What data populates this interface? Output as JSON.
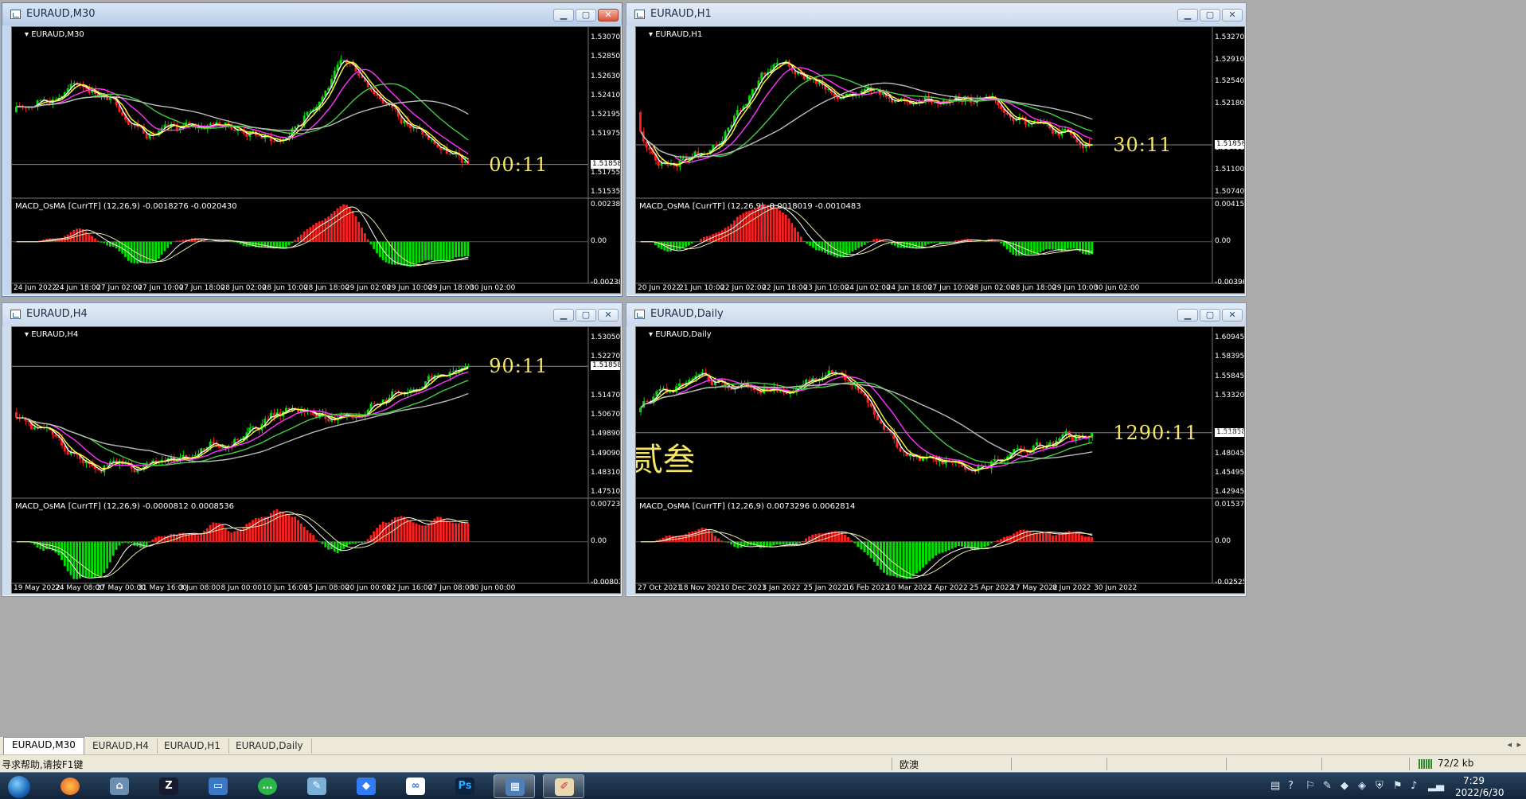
{
  "windows": [
    {
      "id": "m30",
      "title": "EURAUD,M30",
      "label": "EURAUD,M30",
      "active": true,
      "countdown": "00:11",
      "price_axis": [
        "1.53070",
        "1.52850",
        "1.52630",
        "1.52410",
        "1.52195",
        "1.51975",
        "1.51858",
        "1.51755",
        "1.51535"
      ],
      "current_price": "1.51858",
      "indicator_label": "MACD_OsMA [CurrTF] (12,26,9) -0.0018276 -0.0020430",
      "indicator_axis": [
        "0.0023855",
        "0.00",
        "-0.002383"
      ],
      "x_labels": [
        "24 Jun 2022",
        "24 Jun 18:00",
        "27 Jun 02:00",
        "27 Jun 10:00",
        "27 Jun 18:00",
        "28 Jun 02:00",
        "28 Jun 10:00",
        "28 Jun 18:00",
        "29 Jun 02:00",
        "29 Jun 10:00",
        "29 Jun 18:00",
        "30 Jun 02:00"
      ]
    },
    {
      "id": "h1",
      "title": "EURAUD,H1",
      "label": "EURAUD,H1",
      "active": false,
      "countdown": "30:11",
      "price_axis": [
        "1.53270",
        "1.52910",
        "1.52540",
        "1.52180",
        "1.51858",
        "1.51460",
        "1.51100",
        "1.50740"
      ],
      "current_price": "1.51858",
      "indicator_label": "MACD_OsMA [CurrTF] (12,26,9) -0.0018019 -0.0010483",
      "indicator_axis": [
        "0.0041574",
        "0.00",
        "-0.003964"
      ],
      "x_labels": [
        "20 Jun 2022",
        "21 Jun 10:00",
        "22 Jun 02:00",
        "22 Jun 18:00",
        "23 Jun 10:00",
        "24 Jun 02:00",
        "24 Jun 18:00",
        "27 Jun 10:00",
        "28 Jun 02:00",
        "28 Jun 18:00",
        "29 Jun 10:00",
        "30 Jun 02:00"
      ]
    },
    {
      "id": "h4",
      "title": "EURAUD,H4",
      "label": "EURAUD,H4",
      "active": false,
      "countdown": "90:11",
      "price_axis": [
        "1.53050",
        "1.52270",
        "1.51858",
        "1.51470",
        "1.50670",
        "1.49890",
        "1.49090",
        "1.48310",
        "1.47510"
      ],
      "current_price": "1.51858",
      "indicator_label": "MACD_OsMA [CurrTF] (12,26,9) -0.0000812 0.0008536",
      "indicator_axis": [
        "0.0072394",
        "0.00",
        "-0.008013"
      ],
      "x_labels": [
        "19 May 2022",
        "24 May 08:00",
        "27 May 00:00",
        "31 May 16:00",
        "3 Jun 08:00",
        "8 Jun 00:00",
        "10 Jun 16:00",
        "15 Jun 08:00",
        "20 Jun 00:00",
        "22 Jun 16:00",
        "27 Jun 08:00",
        "30 Jun 00:00"
      ]
    },
    {
      "id": "d1",
      "title": "EURAUD,Daily",
      "label": "EURAUD,Daily",
      "active": false,
      "countdown": "1290:11",
      "overlay_text": "贰叁",
      "price_axis": [
        "1.60945",
        "1.58395",
        "1.55845",
        "1.53320",
        "1.51858",
        "1.50670",
        "1.48045",
        "1.45495",
        "1.42945"
      ],
      "current_price": "1.51858",
      "indicator_label": "MACD_OsMA [CurrTF] (12,26,9) 0.0073296 0.0062814",
      "indicator_axis": [
        "0.0153772",
        "0.00",
        "-0.025250"
      ],
      "x_labels": [
        "27 Oct 2021",
        "18 Nov 2021",
        "10 Dec 2021",
        "3 Jan 2022",
        "25 Jan 2022",
        "16 Feb 2022",
        "10 Mar 2022",
        "1 Apr 2022",
        "25 Apr 2022",
        "17 May 2022",
        "8 Jun 2022",
        "30 Jun 2022"
      ]
    }
  ],
  "tabs": [
    "EURAUD,M30",
    "EURAUD,H4",
    "EURAUD,H1",
    "EURAUD,Daily"
  ],
  "active_tab": "EURAUD,M30",
  "status": {
    "help": "寻求帮助,请按F1键",
    "profile": "欧澳",
    "traffic": "72/2 kb"
  },
  "clock": {
    "time": "7:29",
    "date": "2022/6/30"
  },
  "taskbar_apps": [
    "start-orb",
    "firefox-icon",
    "network-icon",
    "metatrader-icon",
    "monitor-icon",
    "wechat-icon",
    "notepad-icon",
    "feishu-icon",
    "baidu-icon",
    "photoshop-icon",
    "metatrader-window-icon",
    "paint-icon"
  ],
  "colors": {
    "bull": "#00e000",
    "bear": "#ff1f1f",
    "ma_fast": "#ffffff",
    "ma_yellow": "#ffff33",
    "ma_magenta": "#ff33ff",
    "ma_green": "#44cc44",
    "ma_gray": "#bbbbbb",
    "countdown": "#f5e663"
  }
}
